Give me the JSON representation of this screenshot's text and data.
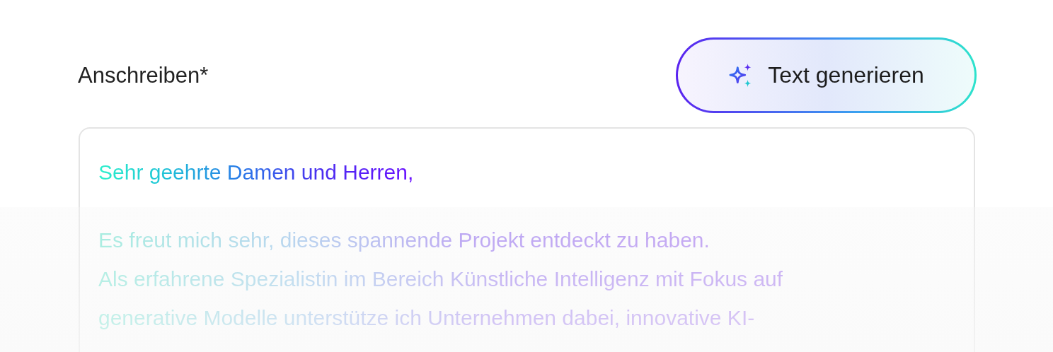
{
  "field": {
    "label": "Anschreiben*",
    "greeting": "Sehr geehrte Damen und Herren,",
    "body_lines": [
      "Es freut mich sehr, dieses spannende Projekt entdeckt zu haben.",
      "Als erfahrene Spezialistin im Bereich Künstliche Intelligenz mit Fokus auf",
      "generative Modelle unterstütze ich Unternehmen dabei, innovative KI-"
    ]
  },
  "generate_button": {
    "label": "Text generieren"
  }
}
